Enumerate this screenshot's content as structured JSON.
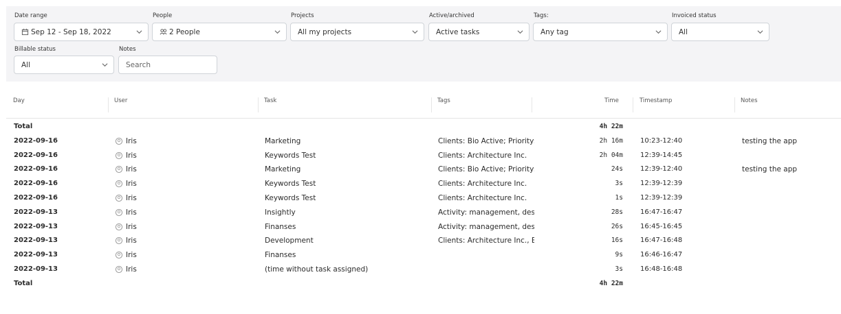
{
  "filters": {
    "date_range": {
      "label": "Date range",
      "value": "Sep 12 - Sep 18, 2022"
    },
    "people": {
      "label": "People",
      "value": "2 People"
    },
    "projects": {
      "label": "Projects",
      "value": "All my projects"
    },
    "active_archived": {
      "label": "Active/archived",
      "value": "Active tasks"
    },
    "tags": {
      "label": "Tags:",
      "value": "Any tag"
    },
    "invoiced": {
      "label": "Invoiced status",
      "value": "All"
    },
    "billable": {
      "label": "Billable status",
      "value": "All"
    },
    "notes": {
      "label": "Notes",
      "placeholder": "Search"
    }
  },
  "table": {
    "headers": {
      "day": "Day",
      "user": "User",
      "task": "Task",
      "tags": "Tags",
      "time": "Time",
      "timestamp": "Timestamp",
      "notes": "Notes"
    },
    "total_top": {
      "label": "Total",
      "time": "4h 22m"
    },
    "rows": [
      {
        "day": "2022-09-16",
        "user": "Iris",
        "task": "Marketing",
        "tags": "Clients: Bio Active; Priority: Mi",
        "time": "2h 16m",
        "timestamp": "10:23-12:40",
        "notes": "testing the app"
      },
      {
        "day": "2022-09-16",
        "user": "Iris",
        "task": "Keywords Test",
        "tags": "Clients: Architecture Inc.",
        "time": "2h 04m",
        "timestamp": "12:39-14:45",
        "notes": ""
      },
      {
        "day": "2022-09-16",
        "user": "Iris",
        "task": "Marketing",
        "tags": "Clients: Bio Active; Priority: Mi",
        "time": "24s",
        "timestamp": "12:39-12:40",
        "notes": "testing the app"
      },
      {
        "day": "2022-09-16",
        "user": "Iris",
        "task": "Keywords Test",
        "tags": "Clients: Architecture Inc.",
        "time": "3s",
        "timestamp": "12:39-12:39",
        "notes": ""
      },
      {
        "day": "2022-09-16",
        "user": "Iris",
        "task": "Keywords Test",
        "tags": "Clients: Architecture Inc.",
        "time": "1s",
        "timestamp": "12:39-12:39",
        "notes": ""
      },
      {
        "day": "2022-09-13",
        "user": "Iris",
        "task": "Insightly",
        "tags": "Activity: management, desig",
        "time": "28s",
        "timestamp": "16:47-16:47",
        "notes": ""
      },
      {
        "day": "2022-09-13",
        "user": "Iris",
        "task": "Finanses",
        "tags": "Activity: management, desig",
        "time": "26s",
        "timestamp": "16:45-16:45",
        "notes": ""
      },
      {
        "day": "2022-09-13",
        "user": "Iris",
        "task": "Development",
        "tags": "Clients: Architecture Inc., BRS",
        "time": "16s",
        "timestamp": "16:47-16:48",
        "notes": ""
      },
      {
        "day": "2022-09-13",
        "user": "Iris",
        "task": "Finanses",
        "tags": "",
        "time": "9s",
        "timestamp": "16:46-16:47",
        "notes": ""
      },
      {
        "day": "2022-09-13",
        "user": "Iris",
        "task": "(time without task assigned)",
        "tags": "",
        "time": "3s",
        "timestamp": "16:48-16:48",
        "notes": ""
      }
    ],
    "total_bottom": {
      "label": "Total",
      "time": "4h 22m"
    }
  },
  "icons": {
    "chevron": "chevron-down-icon",
    "calendar": "calendar-icon",
    "people": "people-icon",
    "avatar": "user-avatar-icon"
  }
}
